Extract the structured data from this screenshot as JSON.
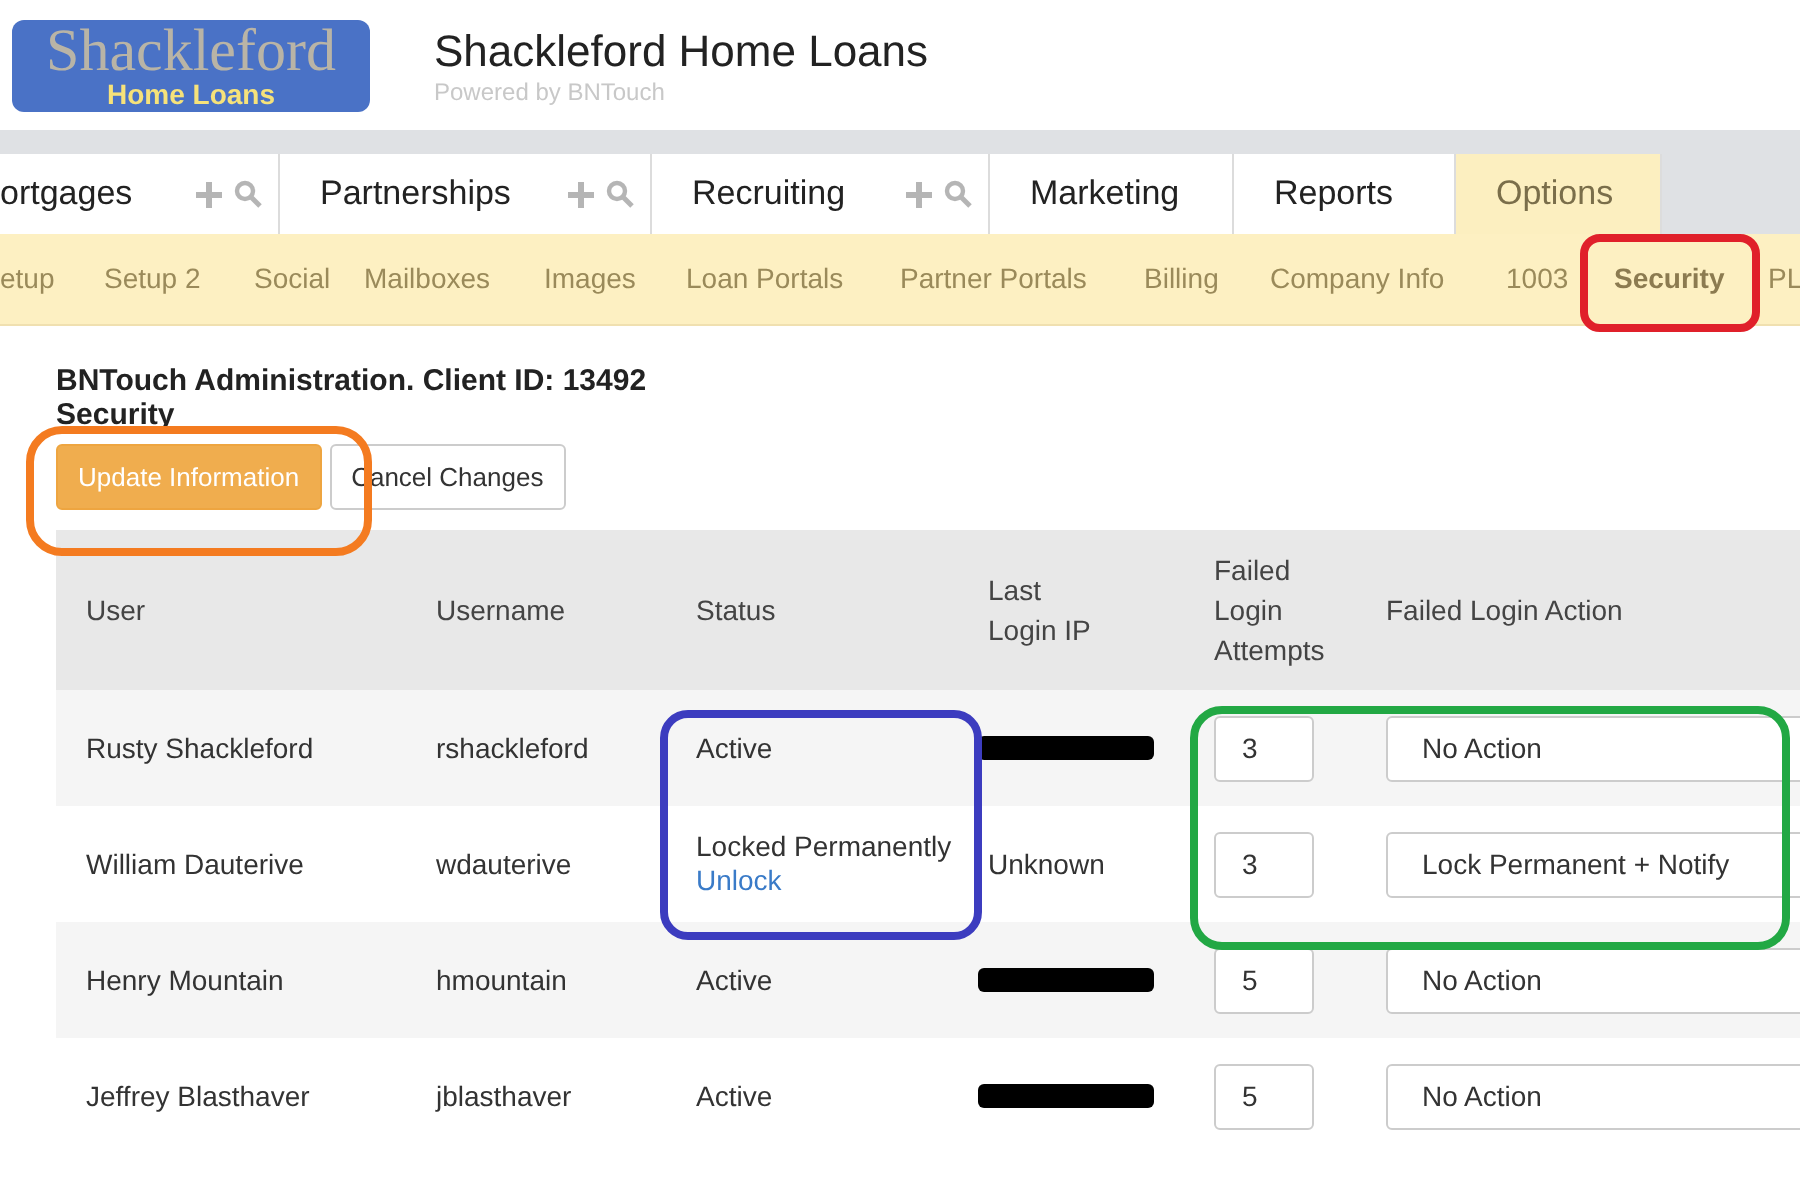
{
  "header": {
    "logo_top": "Shackleford",
    "logo_bottom": "Home Loans",
    "title": "Shackleford Home Loans",
    "subtitle": "Powered by BNTouch"
  },
  "tabs": [
    {
      "label": "ortgages",
      "tools": true,
      "selected": false
    },
    {
      "label": "Partnerships",
      "tools": true,
      "selected": false
    },
    {
      "label": "Recruiting",
      "tools": true,
      "selected": false
    },
    {
      "label": "Marketing",
      "tools": false,
      "selected": false
    },
    {
      "label": "Reports",
      "tools": false,
      "selected": false
    },
    {
      "label": "Options",
      "tools": false,
      "selected": true
    }
  ],
  "subtabs": [
    {
      "label": "etup",
      "selected": false
    },
    {
      "label": "Setup 2",
      "selected": false
    },
    {
      "label": "Social",
      "selected": false
    },
    {
      "label": "Mailboxes",
      "selected": false
    },
    {
      "label": "Images",
      "selected": false
    },
    {
      "label": "Loan Portals",
      "selected": false
    },
    {
      "label": "Partner Portals",
      "selected": false
    },
    {
      "label": "Billing",
      "selected": false
    },
    {
      "label": "Company Info",
      "selected": false
    },
    {
      "label": "1003",
      "selected": false
    },
    {
      "label": "Security",
      "selected": true
    },
    {
      "label": "PL",
      "selected": false
    }
  ],
  "heading": "BNTouch Administration. Client ID: 13492",
  "subheading": "Security",
  "buttons": [
    {
      "label": "Update Information",
      "kind": "primary"
    },
    {
      "label": "Cancel Changes",
      "kind": "default"
    }
  ],
  "table": {
    "columns": [
      "User",
      "Username",
      "Status",
      "Last Login IP",
      "Failed Login Attempts",
      "Failed Login Action"
    ],
    "rows": [
      {
        "user": "Rusty Shackleford",
        "username": "rshackleford",
        "status": "Active",
        "ip_redacted": true,
        "failed_attempts": "3",
        "action": "No Action"
      },
      {
        "user": "William Dauterive",
        "username": "wdauterive",
        "status": "Locked Permanently",
        "status_link": "Unlock",
        "ip_redacted": false,
        "last_login_ip": "Unknown",
        "failed_attempts": "3",
        "action": "Lock Permanent + Notify"
      },
      {
        "user": "Henry Mountain",
        "username": "hmountain",
        "status": "Active",
        "ip_redacted": true,
        "failed_attempts": "5",
        "action": "No Action"
      },
      {
        "user": "Jeffrey Blasthaver",
        "username": "jblasthaver",
        "status": "Active",
        "ip_redacted": true,
        "failed_attempts": "5",
        "action": "No Action"
      }
    ]
  },
  "annotations": [
    {
      "color": "#f47b20"
    },
    {
      "color": "#e0202a"
    },
    {
      "color": "#3c3cbf"
    },
    {
      "color": "#22a844"
    }
  ]
}
